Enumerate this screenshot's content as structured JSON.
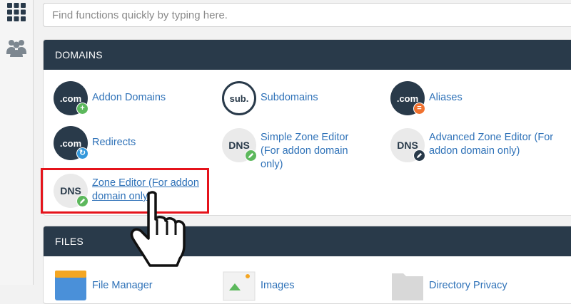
{
  "search": {
    "placeholder": "Find functions quickly by typing here."
  },
  "sidebar": {
    "items": [
      {
        "icon": "grid-icon"
      },
      {
        "icon": "users-icon"
      }
    ]
  },
  "domains": {
    "header": "DOMAINS",
    "items": [
      {
        "label": "Addon Domains",
        "icon_text": ".com",
        "badge_color": "#5cb85c",
        "badge_glyph": "+"
      },
      {
        "label": "Subdomains",
        "icon_text": "sub."
      },
      {
        "label": "Aliases",
        "icon_text": ".com",
        "badge_color": "#f0712e",
        "badge_glyph": "="
      },
      {
        "label": "Redirects",
        "icon_text": ".com",
        "badge_color": "#3498db",
        "badge_glyph": "↻"
      },
      {
        "label": "Simple Zone Editor (For addon domain only)",
        "icon_text": "DNS",
        "badge_color": "#5cb85c"
      },
      {
        "label": "Advanced Zone Editor (For addon domain only)",
        "icon_text": "DNS",
        "badge_color": "#293a4a"
      },
      {
        "label": "Zone Editor (For addon domain only)",
        "icon_text": "DNS",
        "badge_color": "#5cb85c"
      }
    ]
  },
  "files": {
    "header": "FILES",
    "items": [
      {
        "label": "File Manager"
      },
      {
        "label": "Images"
      },
      {
        "label": "Directory Privacy"
      }
    ]
  },
  "colors": {
    "header_bg": "#293a4a",
    "link": "#2f72b8",
    "highlight": "#e5131b"
  }
}
